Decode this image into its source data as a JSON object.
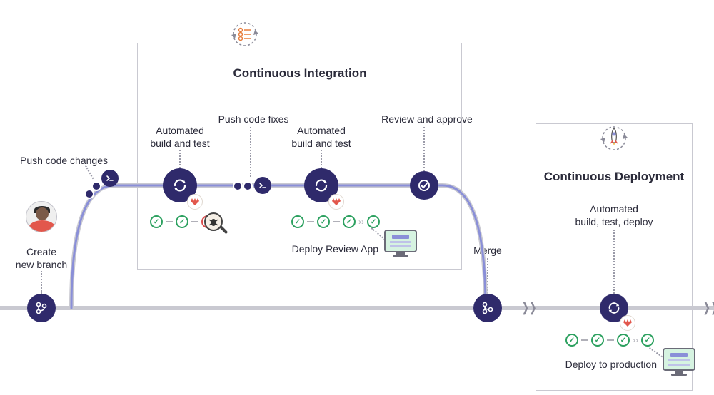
{
  "sections": {
    "ci_title": "Continuous Integration",
    "cd_title": "Continuous Deployment"
  },
  "steps": {
    "create_branch": "Create\nnew branch",
    "push_changes": "Push code changes",
    "auto_build_test_1": "Automated\nbuild and test",
    "push_fixes": "Push code fixes",
    "auto_build_test_2": "Automated\nbuild and test",
    "deploy_review_app": "Deploy Review App",
    "review_approve": "Review and approve",
    "merge": "Merge",
    "auto_build_test_deploy": "Automated\nbuild, test, deploy",
    "deploy_production": "Deploy to production"
  },
  "colors": {
    "node": "#2f2a6b",
    "success": "#2da160",
    "fail": "#d94c4c",
    "line": "#c9c9d1",
    "accent": "#e2574c"
  }
}
